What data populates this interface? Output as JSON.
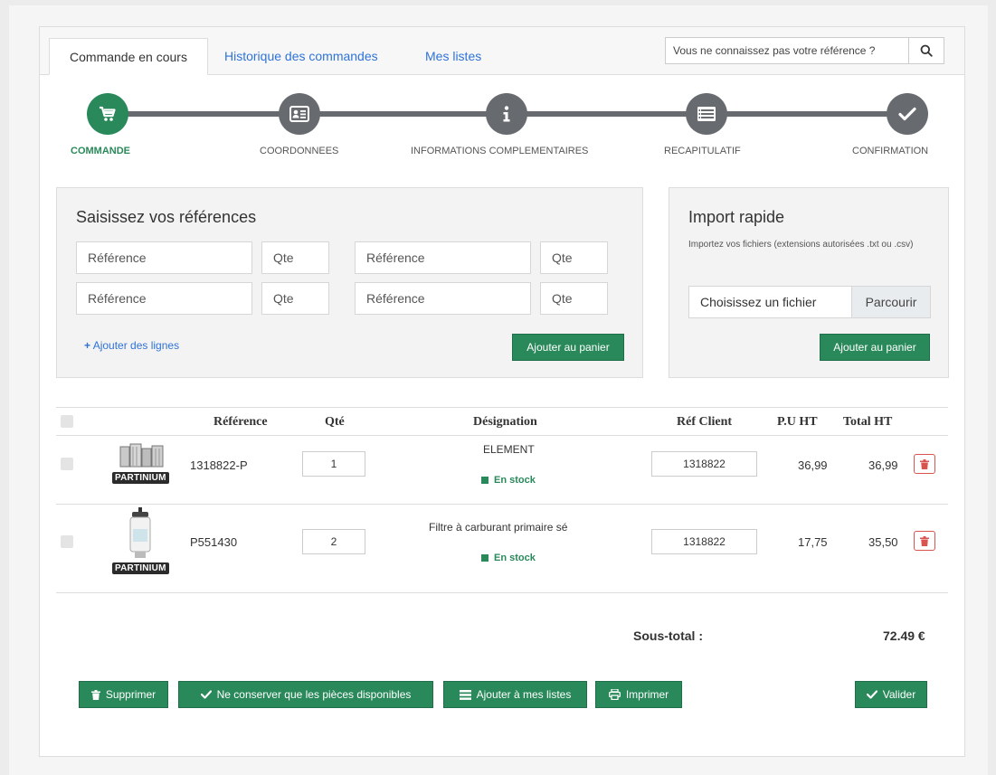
{
  "tabs": [
    {
      "label": "Commande en cours",
      "active": true
    },
    {
      "label": "Historique des commandes"
    },
    {
      "label": "Mes listes"
    }
  ],
  "search": {
    "placeholder": "Vous ne connaissez pas votre référence ?",
    "icon": "search-icon"
  },
  "steps": [
    {
      "label": "COMMANDE",
      "icon": "cart-icon",
      "active": true
    },
    {
      "label": "COORDONNEES",
      "icon": "id-card-icon"
    },
    {
      "label": "INFORMATIONS COMPLEMENTAIRES",
      "icon": "info-icon"
    },
    {
      "label": "RECAPITULATIF",
      "icon": "list-icon"
    },
    {
      "label": "CONFIRMATION",
      "icon": "check-icon"
    }
  ],
  "references_panel": {
    "title": "Saisissez vos références",
    "ref_placeholder": "Référence",
    "qty_placeholder": "Qte",
    "add_lines": "Ajouter des lignes",
    "add_to_cart": "Ajouter au panier"
  },
  "import_panel": {
    "title": "Import rapide",
    "description": "Importez vos fichiers (extensions autorisées .txt ou .csv)",
    "file_placeholder": "Choisissez un fichier",
    "browse": "Parcourir",
    "add_to_cart": "Ajouter au panier"
  },
  "table": {
    "headers": {
      "reference": "Référence",
      "qty": "Qté",
      "designation": "Désignation",
      "client_ref": "Réf Client",
      "unit_price": "P.U HT",
      "total": "Total HT"
    },
    "rows": [
      {
        "brand": "PARTINIUM",
        "reference": "1318822-P",
        "qty": "1",
        "designation": "ELEMENT",
        "stock": "En stock",
        "client_ref": "1318822",
        "unit_price": "36,99",
        "total": "36,99"
      },
      {
        "brand": "PARTINIUM",
        "reference": "P551430",
        "qty": "2",
        "designation": "Filtre à carburant primaire sé",
        "stock": "En stock",
        "client_ref": "1318822",
        "unit_price": "17,75",
        "total": "35,50"
      }
    ]
  },
  "subtotal": {
    "label": "Sous-total :",
    "value": "72.49 €"
  },
  "actions": {
    "delete": "Supprimer",
    "keep_available": "Ne conserver que les pièces disponibles",
    "add_to_lists": "Ajouter à mes listes",
    "print": "Imprimer",
    "validate": "Valider"
  },
  "colors": {
    "accent_green": "#29895a",
    "link_blue": "#2f73d8",
    "step_gray": "#676b70",
    "danger_red": "#d9534f"
  }
}
